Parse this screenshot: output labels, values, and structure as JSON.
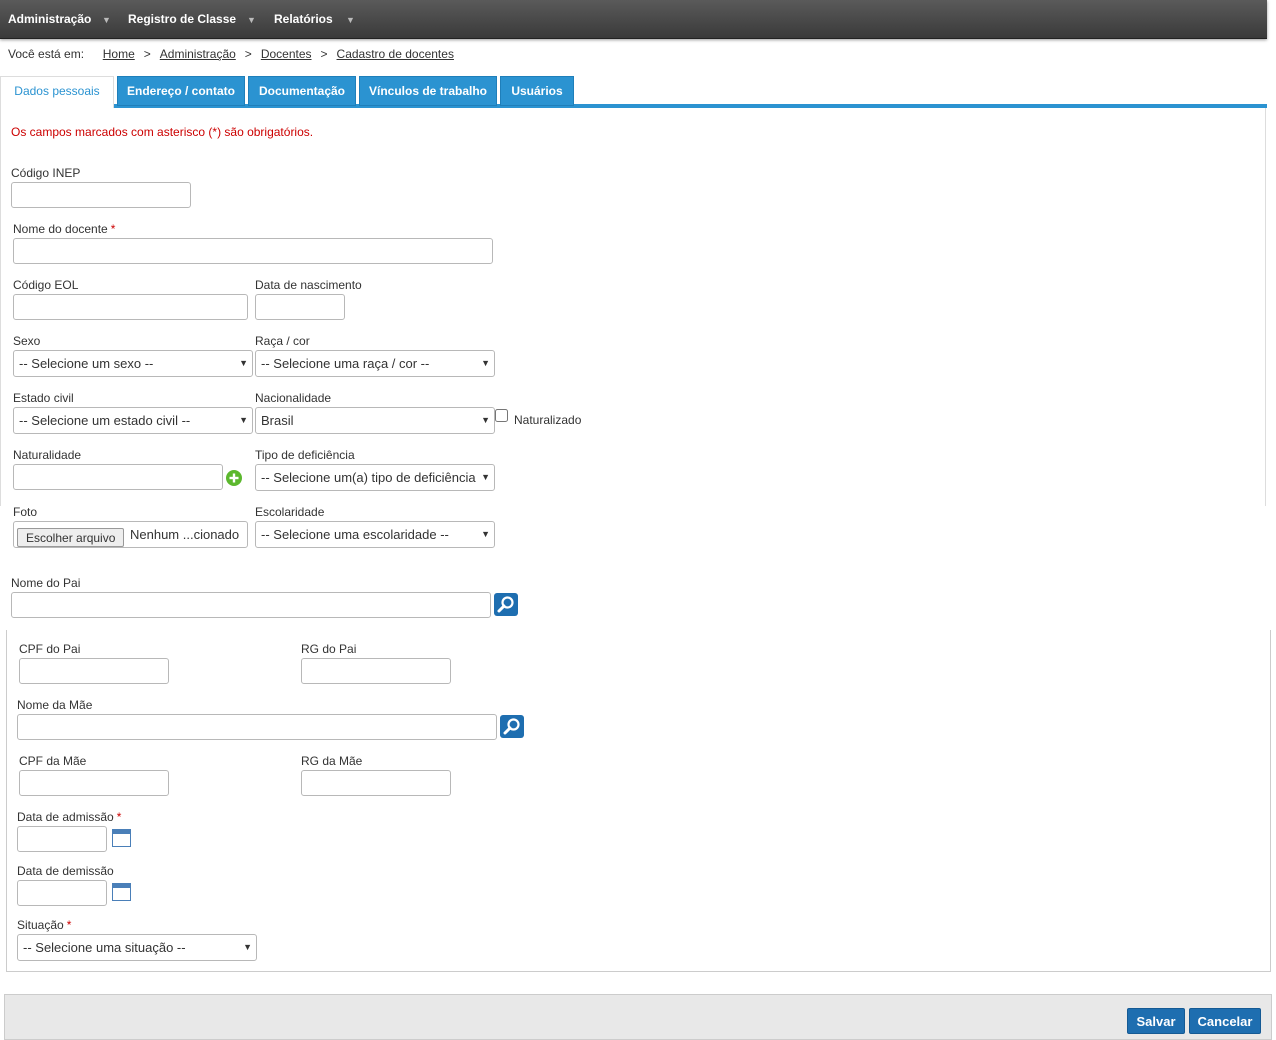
{
  "nav": {
    "items": [
      "Administração",
      "Registro de Classe",
      "Relatórios"
    ]
  },
  "breadcrumb": {
    "prefix": "Você está em:",
    "items": [
      "Home",
      "Administração",
      "Docentes",
      "Cadastro de docentes"
    ]
  },
  "tabs": [
    "Dados pessoais",
    "Endereço / contato",
    "Documentação",
    "Vínculos de trabalho",
    "Usuários"
  ],
  "form": {
    "required_note": "Os campos marcados com asterisco (*) são obrigatórios.",
    "codigo_inep": "Código INEP",
    "nome_docente": "Nome do docente",
    "required_mark": "*",
    "codigo_eol": "Código EOL",
    "data_nascimento": "Data de nascimento",
    "sexo": {
      "label": "Sexo",
      "value": "-- Selecione um sexo --"
    },
    "raca": {
      "label": "Raça / cor",
      "value": "-- Selecione uma raça / cor --"
    },
    "estado_civil": {
      "label": "Estado civil",
      "value": "-- Selecione um estado civil --"
    },
    "nacionalidade": {
      "label": "Nacionalidade",
      "value": "Brasil"
    },
    "naturalizado": "Naturalizado",
    "naturalidade": "Naturalidade",
    "deficiencia": {
      "label": "Tipo de deficiência",
      "value": "-- Selecione um(a) tipo de deficiência --"
    },
    "foto": {
      "label": "Foto",
      "button": "Escolher arquivo",
      "status": "Nenhum ...cionado"
    },
    "escolaridade": {
      "label": "Escolaridade",
      "value": "-- Selecione uma escolaridade --"
    },
    "nome_pai": "Nome do Pai",
    "cpf_pai": "CPF do Pai",
    "rg_pai": "RG do Pai",
    "nome_mae": "Nome da Mãe",
    "cpf_mae": "CPF da Mãe",
    "rg_mae": "RG da Mãe",
    "data_admissao": "Data de admissão",
    "data_demissao": "Data de demissão",
    "situacao": {
      "label": "Situação",
      "value": "-- Selecione uma situação --"
    }
  },
  "footer": {
    "save": "Salvar",
    "cancel": "Cancelar"
  },
  "colors": {
    "accent": "#2b93d1",
    "button": "#1e6eb0",
    "required": "#cc0000",
    "add_icon": "#5cb82e"
  }
}
